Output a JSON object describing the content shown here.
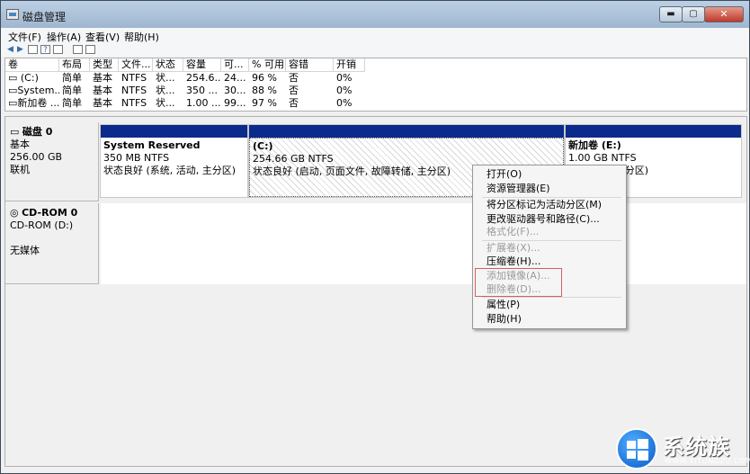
{
  "window": {
    "title": "磁盘管理",
    "min_label": "▬",
    "max_label": "▢",
    "close_label": "✕"
  },
  "menubar": {
    "items": [
      "文件(F)",
      "操作(A)",
      "查看(V)",
      "帮助(H)"
    ]
  },
  "toolbar": {
    "icons": [
      "back-icon",
      "forward-icon",
      "list-view-icon",
      "help-icon",
      "properties-icon",
      "refresh-icon",
      "help-book-icon"
    ]
  },
  "volume_list": {
    "columns": [
      "卷",
      "布局",
      "类型",
      "文件...",
      "状态",
      "容量",
      "可...",
      "% 可用",
      "容错",
      "开销"
    ],
    "rows": [
      [
        "(C:)",
        "简单",
        "基本",
        "NTFS",
        "状...",
        "254.6...",
        "24...",
        "96 %",
        "否",
        "0%"
      ],
      [
        "System...",
        "简单",
        "基本",
        "NTFS",
        "状...",
        "350 ...",
        "30...",
        "88 %",
        "否",
        "0%"
      ],
      [
        "新加卷 ...",
        "简单",
        "基本",
        "NTFS",
        "状...",
        "1.00 ...",
        "99...",
        "97 %",
        "否",
        "0%"
      ]
    ]
  },
  "disks": [
    {
      "name": "磁盘 0",
      "type": "基本",
      "size": "256.00 GB",
      "status": "联机",
      "partitions": [
        {
          "name": "System Reserved",
          "size": "350 MB NTFS",
          "status": "状态良好 (系统, 活动, 主分区)"
        },
        {
          "name": "(C:)",
          "size": "254.66 GB NTFS",
          "status": "状态良好 (启动, 页面文件, 故障转储, 主分区)"
        },
        {
          "name": "新加卷 (E:)",
          "size": "1.00 GB NTFS",
          "status": "状态良好 (主分区)"
        }
      ]
    },
    {
      "name": "CD-ROM 0",
      "type": "CD-ROM (D:)",
      "size": "",
      "status": "无媒体"
    }
  ],
  "context_menu": {
    "items": [
      {
        "label": "打开(O)",
        "enabled": true
      },
      {
        "label": "资源管理器(E)",
        "enabled": true
      },
      {
        "label": "将分区标记为活动分区(M)",
        "enabled": true
      },
      {
        "label": "更改驱动器号和路径(C)...",
        "enabled": true
      },
      {
        "label": "格式化(F)...",
        "enabled": false
      },
      {
        "label": "扩展卷(X)...",
        "enabled": false
      },
      {
        "label": "压缩卷(H)...",
        "enabled": true
      },
      {
        "label": "添加镜像(A)...",
        "enabled": false
      },
      {
        "label": "删除卷(D)...",
        "enabled": false
      },
      {
        "label": "属性(P)",
        "enabled": true
      },
      {
        "label": "帮助(H)",
        "enabled": true
      }
    ],
    "highlight_color": "#d06060"
  },
  "watermark": {
    "text": "系统族",
    "url": "WWW.XITONGZU.COM"
  },
  "colors": {
    "partition_bar": "#0a2a8c",
    "title_gradient_top": "#bcd0e4",
    "close_red": "#c0392b"
  }
}
